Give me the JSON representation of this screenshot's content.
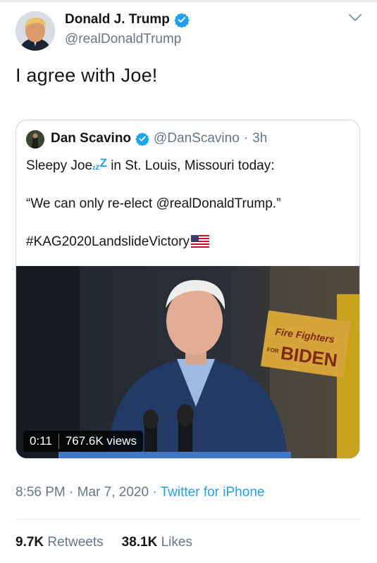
{
  "author": {
    "name": "Donald J. Trump",
    "handle": "@realDonaldTrump",
    "avatar_icon": "profile-photo"
  },
  "tweet": {
    "text": "I agree with Joe!"
  },
  "quoted": {
    "name": "Dan Scavino",
    "handle": "@DanScavino",
    "separator": "·",
    "time": "3h",
    "line1_prefix": "Sleepy Joe",
    "zzz": [
      "z",
      "z",
      "Z"
    ],
    "line1_suffix": "in St. Louis, Missouri today:",
    "line2": "“We can only re-elect @realDonaldTrump.”",
    "line3": "#KAG2020LandslideVictory",
    "video": {
      "duration": "0:11",
      "views": "767.6K views",
      "sign_line1": "Fire Fighters",
      "sign_line2": "FOR",
      "sign_line3": "BIDEN"
    }
  },
  "meta": {
    "time": "8:56 PM",
    "dot1": "·",
    "date": "Mar 7, 2020",
    "dot2": "·",
    "source": "Twitter for iPhone"
  },
  "stats": {
    "retweets_count": "9.7K",
    "retweets_label": "Retweets",
    "likes_count": "38.1K",
    "likes_label": "Likes"
  },
  "colors": {
    "accent": "#1da1f2",
    "secondary_text": "#657786",
    "border": "#ccd6dd"
  }
}
